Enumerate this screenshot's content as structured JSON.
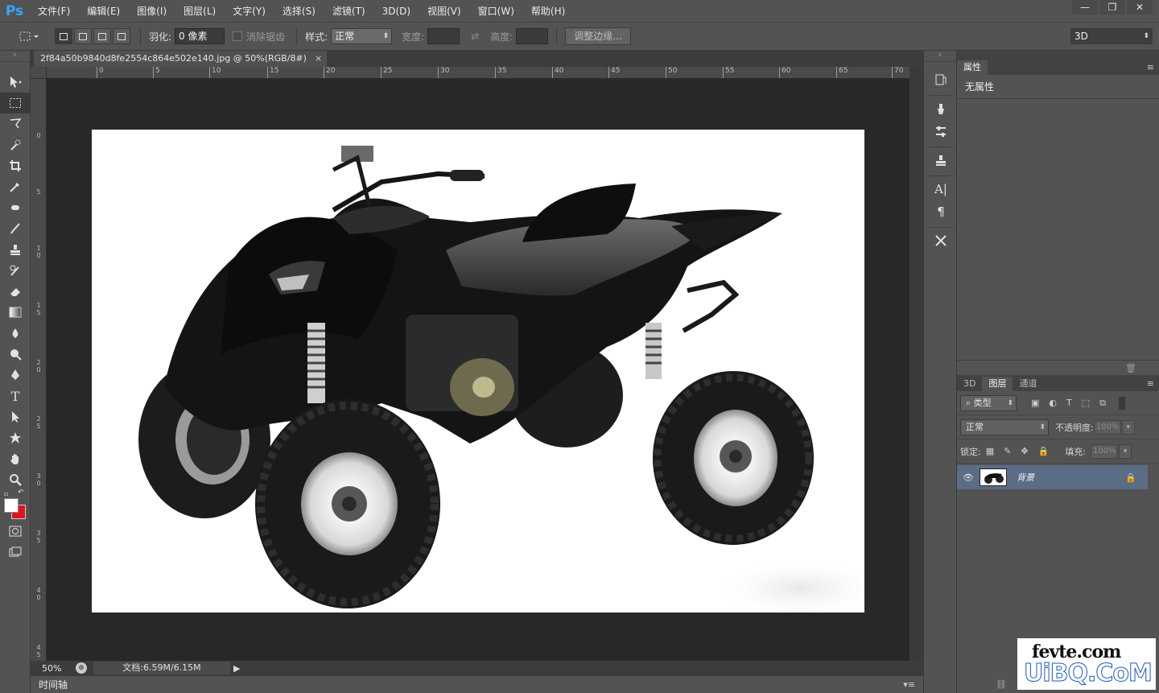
{
  "app": {
    "logo": "Ps"
  },
  "menu": [
    "文件(F)",
    "编辑(E)",
    "图像(I)",
    "图层(L)",
    "文字(Y)",
    "选择(S)",
    "滤镜(T)",
    "3D(D)",
    "视图(V)",
    "窗口(W)",
    "帮助(H)"
  ],
  "window_controls": {
    "minimize": "—",
    "restore": "❐",
    "close": "✕"
  },
  "options": {
    "feather_label": "羽化:",
    "feather_value": "0 像素",
    "antialias_label": "消除锯齿",
    "style_label": "样式:",
    "style_value": "正常",
    "width_label": "宽度:",
    "height_label": "高度:",
    "refine_button": "调整边缘...",
    "workspace": "3D"
  },
  "document": {
    "tab_title": "2f84a50b9840d8fe2554c864e502e140.jpg @ 50%(RGB/8#)",
    "close": "×"
  },
  "ruler": {
    "top_labels": [
      "0",
      "5",
      "10",
      "15",
      "20",
      "25",
      "30",
      "35",
      "40",
      "45",
      "50",
      "55",
      "60",
      "65",
      "70"
    ],
    "left_labels": [
      "0",
      "5",
      "1 0",
      "1 5",
      "2 0",
      "2 5",
      "3 0",
      "3 5",
      "4 0",
      "4 5"
    ]
  },
  "status": {
    "zoom": "50%",
    "doc_size": "文档:6.59M/6.15M"
  },
  "timeline": {
    "label": "时间轴"
  },
  "properties": {
    "tab": "属性",
    "body": "无属性"
  },
  "layers": {
    "tabs": [
      "3D",
      "图层",
      "通道"
    ],
    "active_tab": "图层",
    "filter_kind": "类型",
    "blend_mode": "正常",
    "opacity_label": "不透明度:",
    "opacity_value": "100%",
    "lock_label": "锁定:",
    "fill_label": "填充:",
    "fill_value": "100%",
    "items": [
      {
        "name": "背景",
        "visible": true,
        "locked": true
      }
    ]
  },
  "watermark": {
    "line1": "fevte.com",
    "line2": "UiBQ.CoM"
  },
  "colors": {
    "accent": "#31a8ff",
    "selected_layer": "#5b6c86",
    "foreground": "#ffffff",
    "background": "#e0141e"
  }
}
